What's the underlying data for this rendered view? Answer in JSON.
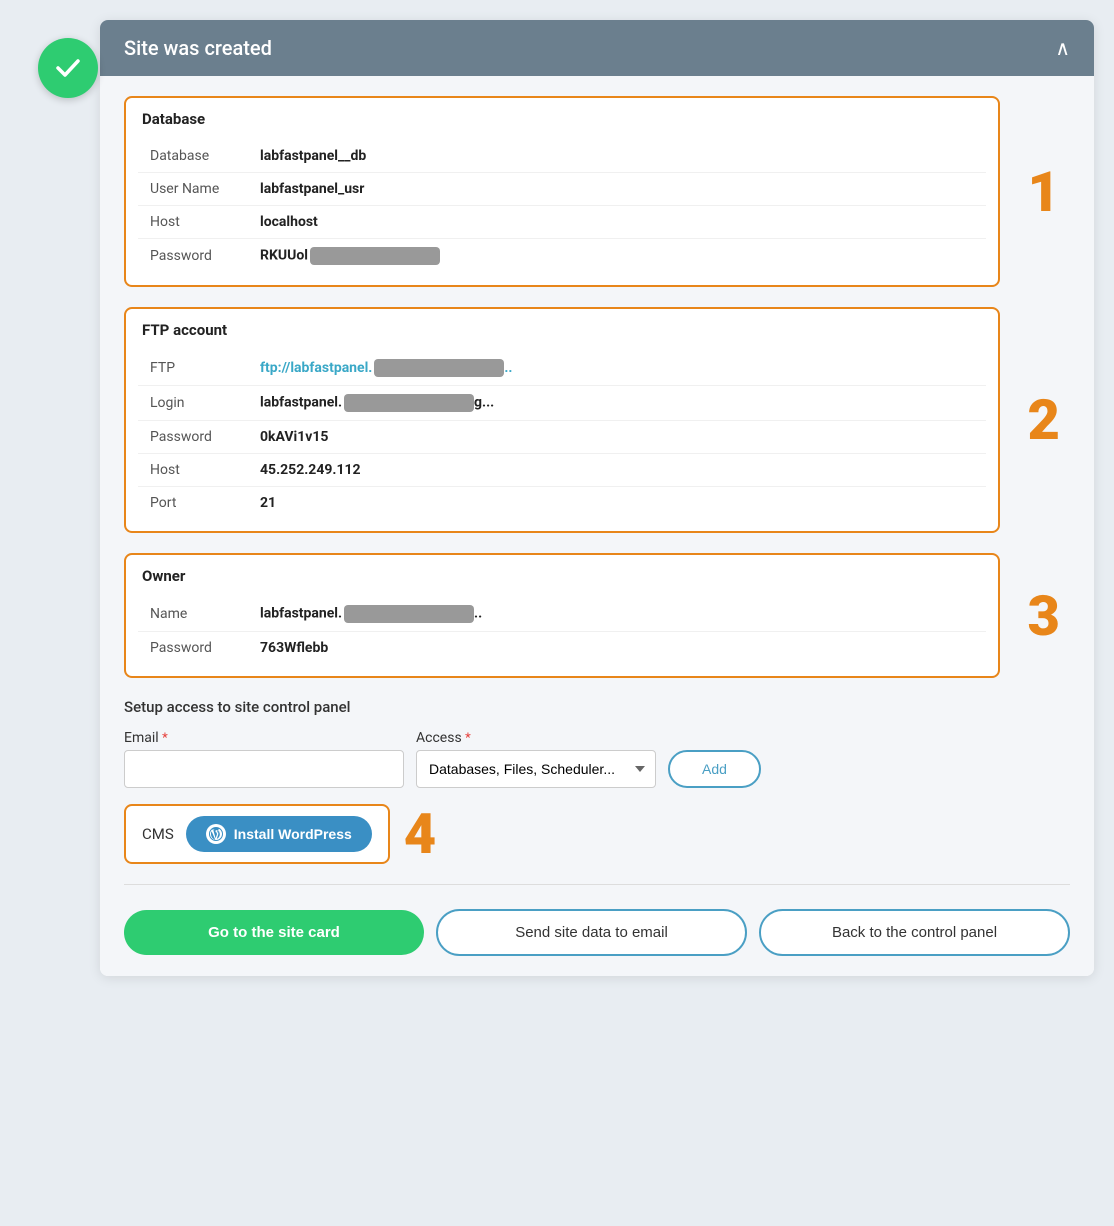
{
  "header": {
    "title": "Site was created",
    "chevron": "∧"
  },
  "success_icon": "✓",
  "sections": {
    "database": {
      "title": "Database",
      "number": "1",
      "fields": [
        {
          "label": "Database",
          "value": "labfastpanel__db",
          "blurred": false
        },
        {
          "label": "User Name",
          "value": "labfastpanel_usr",
          "blurred": false
        },
        {
          "label": "Host",
          "value": "localhost",
          "blurred": false
        },
        {
          "label": "Password",
          "value": "RKUUol",
          "blurred": true
        }
      ]
    },
    "ftp": {
      "title": "FTP account",
      "number": "2",
      "fields": [
        {
          "label": "FTP",
          "value": "ftp://labfastpanel.",
          "blurred": true,
          "is_link": true,
          "suffix": ".."
        },
        {
          "label": "Login",
          "value": "labfastpanel.",
          "blurred": true,
          "suffix": "g..."
        },
        {
          "label": "Password",
          "value": "0kAVi1v15",
          "blurred": false
        },
        {
          "label": "Host",
          "value": "45.252.249.112",
          "blurred": false
        },
        {
          "label": "Port",
          "value": "21",
          "blurred": false
        }
      ]
    },
    "owner": {
      "title": "Owner",
      "number": "3",
      "fields": [
        {
          "label": "Name",
          "value": "labfastpanel.",
          "blurred": true,
          "suffix": ".."
        },
        {
          "label": "Password",
          "value": "763Wflebb",
          "blurred": false
        }
      ]
    }
  },
  "setup": {
    "title": "Setup access to site control panel",
    "email_label": "Email",
    "email_placeholder": "",
    "access_label": "Access",
    "access_value": "Databases, Files, Scheduler...",
    "add_button": "Add"
  },
  "cms": {
    "label": "CMS",
    "install_button": "Install WordPress",
    "number": "4"
  },
  "bottom_actions": {
    "go_to_site": "Go to the site card",
    "send_data": "Send site data to email",
    "back": "Back to the control panel"
  }
}
